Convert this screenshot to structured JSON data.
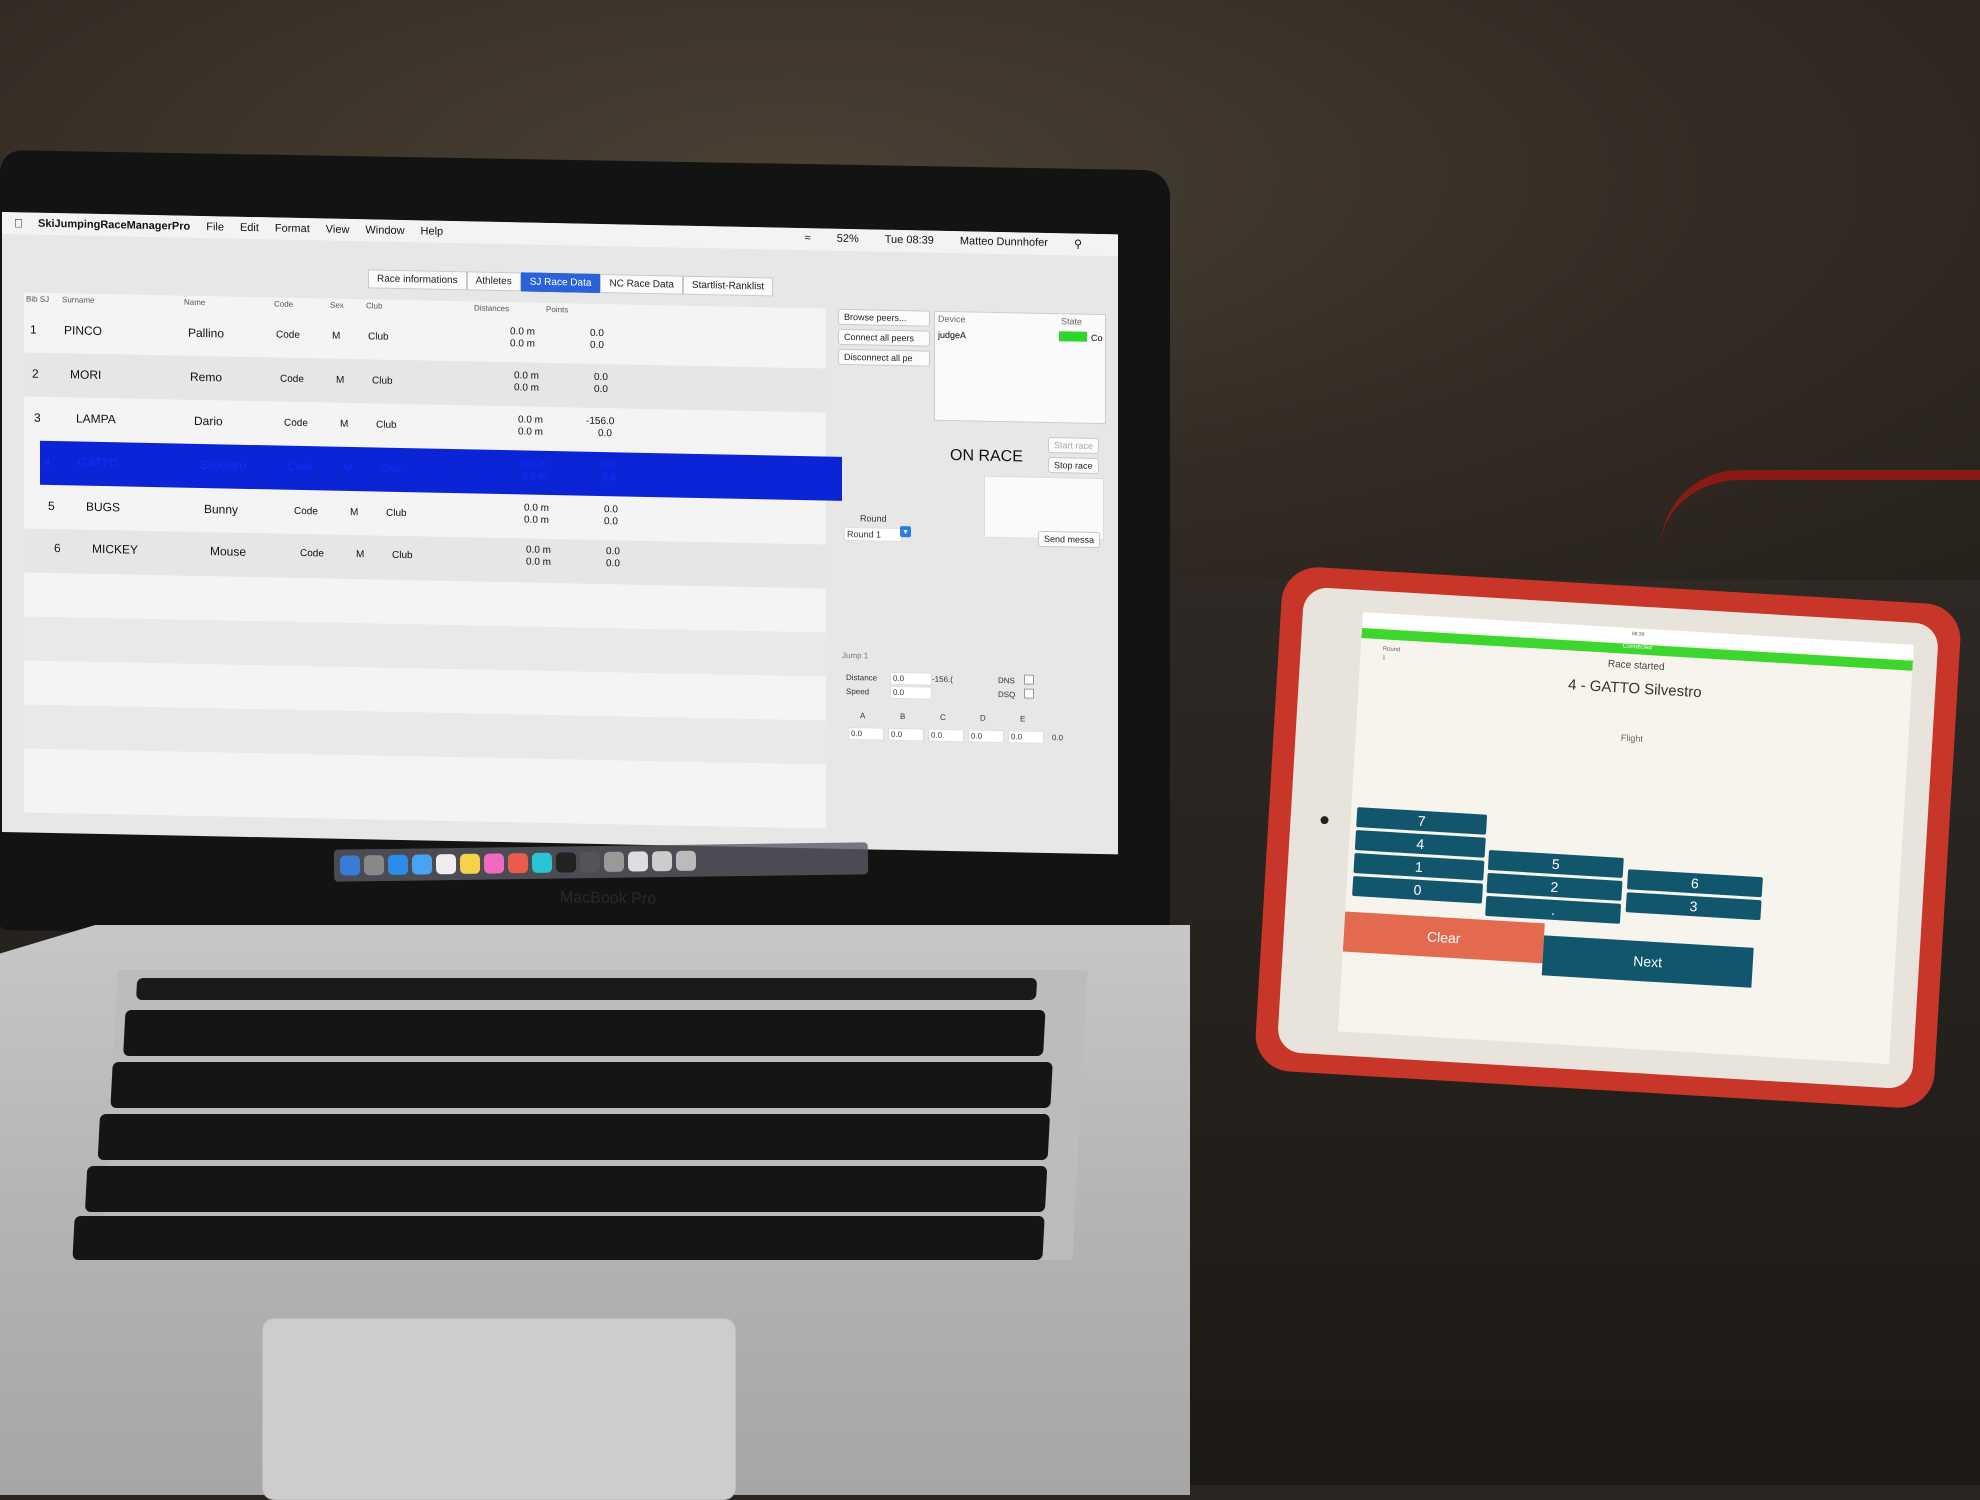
{
  "menubar": {
    "app_name": "SkiJumpingRaceManagerPro",
    "items": [
      "File",
      "Edit",
      "Format",
      "View",
      "Window",
      "Help"
    ],
    "battery": "52%",
    "clock": "Tue 08:39",
    "user": "Matteo Dunnhofer"
  },
  "tabs": [
    "Race informations",
    "Athletes",
    "SJ Race Data",
    "NC Race Data",
    "Startlist-Ranklist"
  ],
  "active_tab": "SJ Race Data",
  "table": {
    "headers": [
      "Bib SJ",
      "Surname",
      "Name",
      "Code",
      "Sex",
      "Club",
      "Distances",
      "Points"
    ],
    "rows": [
      {
        "bib": "1",
        "surname": "PINCO",
        "name": "Pallino",
        "code": "Code",
        "sex": "M",
        "club": "Club",
        "dist1": "0.0 m",
        "dist2": "0.0 m",
        "pts1": "0.0",
        "pts2": "0.0"
      },
      {
        "bib": "2",
        "surname": "MORI",
        "name": "Remo",
        "code": "Code",
        "sex": "M",
        "club": "Club",
        "dist1": "0.0 m",
        "dist2": "0.0 m",
        "pts1": "0.0",
        "pts2": "0.0"
      },
      {
        "bib": "3",
        "surname": "LAMPA",
        "name": "Dario",
        "code": "Code",
        "sex": "M",
        "club": "Club",
        "dist1": "0.0 m",
        "dist2": "0.0 m",
        "pts1": "-156.0",
        "pts2": "0.0"
      },
      {
        "bib": "4",
        "surname": "GATTO",
        "name": "Silvestro",
        "code": "Code",
        "sex": "M",
        "club": "Club",
        "dist1": "0.0 m",
        "dist2": "0.0 m",
        "pts1": "0.0",
        "pts2": "0.0"
      },
      {
        "bib": "5",
        "surname": "BUGS",
        "name": "Bunny",
        "code": "Code",
        "sex": "M",
        "club": "Club",
        "dist1": "0.0 m",
        "dist2": "0.0 m",
        "pts1": "0.0",
        "pts2": "0.0"
      },
      {
        "bib": "6",
        "surname": "MICKEY",
        "name": "Mouse",
        "code": "Code",
        "sex": "M",
        "club": "Club",
        "dist1": "0.0 m",
        "dist2": "0.0 m",
        "pts1": "0.0",
        "pts2": "0.0"
      }
    ],
    "selected_bib": "4"
  },
  "side": {
    "browse": "Browse peers...",
    "connect": "Connect all peers",
    "disconnect": "Disconnect all pe",
    "device_header": "Device",
    "state_header": "State",
    "device_name": "judgeA",
    "device_state": "Co",
    "state_color": "#2fd52a",
    "status": "ON RACE",
    "start": "Start race",
    "stop": "Stop race",
    "send": "Send messa",
    "round_label": "Round",
    "round_value": "Round 1",
    "jump_label": "Jump 1",
    "distance_label": "Distance",
    "distance_value": "0.0",
    "distance_points": "-156.(",
    "speed_label": "Speed",
    "speed_value": "0.0",
    "dns": "DNS",
    "dsq": "DSQ",
    "judges": [
      "A",
      "B",
      "C",
      "D",
      "E"
    ],
    "judge_values": [
      "0.0",
      "0.0",
      "0.0",
      "0.0",
      "0.0",
      "0.0"
    ]
  },
  "laptop_brand": "MacBook Pro",
  "ipad": {
    "clock": "08:39",
    "connection": "Connected",
    "race_status": "Race started",
    "round_label": "Round",
    "round_value": "1",
    "athlete": "4 - GATTO Silvestro",
    "mode": "Flight",
    "keys": [
      "7",
      "4",
      "1",
      "0",
      "5",
      "2",
      ".",
      "6",
      "3"
    ],
    "clear": "Clear",
    "next": "Next",
    "accent_green": "#3dd62e",
    "accent_blue": "#12566e",
    "accent_orange": "#e36a4f"
  }
}
